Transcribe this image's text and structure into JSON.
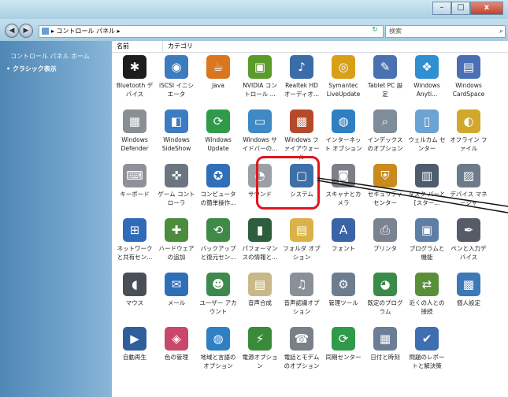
{
  "titlebar": {
    "buttons": [
      "–",
      "□",
      "x"
    ]
  },
  "nav": {
    "address_path": "▸ コントロール パネル ▸",
    "search_placeholder": "検索"
  },
  "sidebar": {
    "home_label": "コントロール パネル ホーム",
    "classic_label": "• クラシック表示"
  },
  "columns": {
    "name": "名前",
    "category": "カテゴリ"
  },
  "items": [
    {
      "label": "Bluetooth デバイス",
      "color": "#1d1d1d",
      "glyph": "✱"
    },
    {
      "label": "iSCSI イニシエータ",
      "color": "#3d7bbf",
      "glyph": "◉"
    },
    {
      "label": "Java",
      "color": "#d9761f",
      "glyph": "☕"
    },
    {
      "label": "NVIDIA コントロール ...",
      "color": "#5a9b2a",
      "glyph": "▣"
    },
    {
      "label": "Realtek HD オーディオ...",
      "color": "#3a6ca8",
      "glyph": "♪"
    },
    {
      "label": "Symantec LiveUpdate",
      "color": "#d8a01a",
      "glyph": "◎"
    },
    {
      "label": "Tablet PC 設定",
      "color": "#4a72b0",
      "glyph": "✎"
    },
    {
      "label": "Windows Anyti...",
      "color": "#2f8fd0",
      "glyph": "❖"
    },
    {
      "label": "Windows CardSpace",
      "color": "#4a6fb5",
      "glyph": "▤"
    },
    {
      "label": "Windows Defender",
      "color": "#8a8f96",
      "glyph": "▦"
    },
    {
      "label": "Windows SideShow",
      "color": "#3b7cc2",
      "glyph": "◧"
    },
    {
      "label": "Windows Update",
      "color": "#2f9a4a",
      "glyph": "⟳"
    },
    {
      "label": "Windows サイドバーの...",
      "color": "#3e89c6",
      "glyph": "▭"
    },
    {
      "label": "Windows ファイアウォール",
      "color": "#b54a2a",
      "glyph": "▩"
    },
    {
      "label": "インターネット オプション",
      "color": "#2f7fc2",
      "glyph": "◍"
    },
    {
      "label": "インデックスのオプション",
      "color": "#7f8c99",
      "glyph": "⌕"
    },
    {
      "label": "ウェルカム センター",
      "color": "#6aa3d4",
      "glyph": "▯"
    },
    {
      "label": "オフライン ファイル",
      "color": "#d3a72a",
      "glyph": "◐"
    },
    {
      "label": "キーボード",
      "color": "#8d9299",
      "glyph": "⌨"
    },
    {
      "label": "ゲーム コントローラ",
      "color": "#6c7580",
      "glyph": "✜"
    },
    {
      "label": "コンピュータの簡単操作...",
      "color": "#2f6fb8",
      "glyph": "✪"
    },
    {
      "label": "サウンド",
      "color": "#9aa0a6",
      "glyph": "◔"
    },
    {
      "label": "システム",
      "color": "#3e6fa8",
      "glyph": "▢"
    },
    {
      "label": "スキャナとカメラ",
      "color": "#7b8088",
      "glyph": "◙"
    },
    {
      "label": "セキュリティ センター",
      "color": "#c98a1e",
      "glyph": "⛨"
    },
    {
      "label": "タスク バーと [スター...",
      "color": "#4d5c6e",
      "glyph": "▥"
    },
    {
      "label": "デバイス マネージャ",
      "color": "#6c7a8a",
      "glyph": "▨"
    },
    {
      "label": "ネットワークと共有セン...",
      "color": "#2f6bb8",
      "glyph": "⊞"
    },
    {
      "label": "ハードウェアの追加",
      "color": "#4c8c3d",
      "glyph": "✚"
    },
    {
      "label": "バックアップと復元セン...",
      "color": "#3f8a46",
      "glyph": "⟲"
    },
    {
      "label": "パフォーマンスの情報と...",
      "color": "#2e5d3e",
      "glyph": "▮"
    },
    {
      "label": "フォルダ オプション",
      "color": "#d9b34a",
      "glyph": "▤"
    },
    {
      "label": "フォント",
      "color": "#3b63a8",
      "glyph": "A"
    },
    {
      "label": "プリンタ",
      "color": "#7a8390",
      "glyph": "⎙"
    },
    {
      "label": "プログラムと機能",
      "color": "#5f7ea6",
      "glyph": "▣"
    },
    {
      "label": "ペンと入力デバイス",
      "color": "#555c66",
      "glyph": "✒"
    },
    {
      "label": "マウス",
      "color": "#4a4f57",
      "glyph": "◖"
    },
    {
      "label": "メール",
      "color": "#2f6fb8",
      "glyph": "✉"
    },
    {
      "label": "ユーザー アカウント",
      "color": "#3d8a4e",
      "glyph": "☻"
    },
    {
      "label": "音声合成",
      "color": "#c9b98a",
      "glyph": "▤"
    },
    {
      "label": "音声認識オプション",
      "color": "#8a9098",
      "glyph": "♫"
    },
    {
      "label": "管理ツール",
      "color": "#6d7d90",
      "glyph": "⚙"
    },
    {
      "label": "既定のプログラム",
      "color": "#3a8a4a",
      "glyph": "◕"
    },
    {
      "label": "近くの人との接続",
      "color": "#5a8f3a",
      "glyph": "⇄"
    },
    {
      "label": "個人設定",
      "color": "#3d78b8",
      "glyph": "▩"
    },
    {
      "label": "自動再生",
      "color": "#2f5f9a",
      "glyph": "▶"
    },
    {
      "label": "色の管理",
      "color": "#c9476a",
      "glyph": "◈"
    },
    {
      "label": "地域と言語のオプション",
      "color": "#2f7fc2",
      "glyph": "◍"
    },
    {
      "label": "電源オプション",
      "color": "#3a8a3a",
      "glyph": "⚡"
    },
    {
      "label": "電話とモデムのオプション",
      "color": "#7a8088",
      "glyph": "☎"
    },
    {
      "label": "同期センター",
      "color": "#2f9a4a",
      "glyph": "⟳"
    },
    {
      "label": "日付と時刻",
      "color": "#6a7e96",
      "glyph": "▦"
    },
    {
      "label": "問題のレポートと解決策",
      "color": "#3e6fb0",
      "glyph": "✔"
    }
  ]
}
